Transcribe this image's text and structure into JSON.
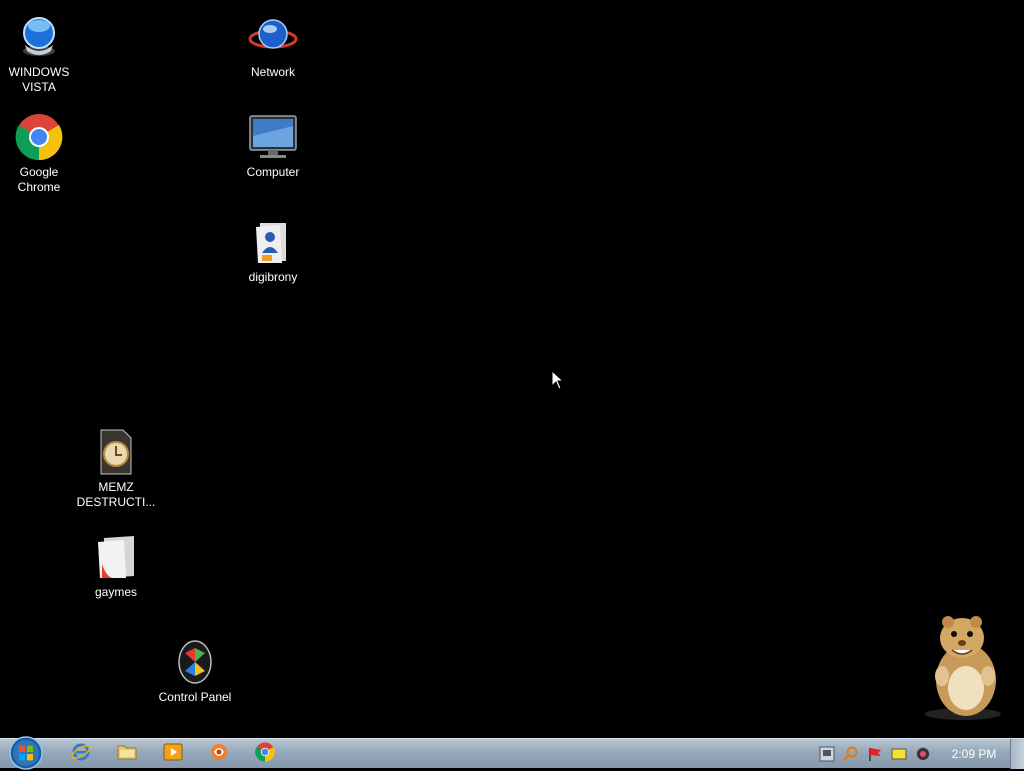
{
  "desktop": {
    "icons": [
      {
        "label": "WINDOWS\nVISTA",
        "icon": "windows-vista-orb-icon"
      },
      {
        "label": "Google\nChrome",
        "icon": "chrome-icon"
      },
      {
        "label": "Network",
        "icon": "network-globe-icon"
      },
      {
        "label": "Computer",
        "icon": "computer-monitor-icon"
      },
      {
        "label": "digibrony",
        "icon": "user-folder-icon"
      },
      {
        "label": "MEMZ\nDESTRUCTI...",
        "icon": "memz-file-icon"
      },
      {
        "label": "gaymes",
        "icon": "folder-icon"
      },
      {
        "label": "Control Panel",
        "icon": "control-panel-icon"
      }
    ]
  },
  "taskbar": {
    "pinned": [
      {
        "name": "internet-explorer",
        "icon": "internet-explorer-icon"
      },
      {
        "name": "file-explorer",
        "icon": "folder-icon"
      },
      {
        "name": "media-player",
        "icon": "media-player-icon"
      },
      {
        "name": "app",
        "icon": "app-icon"
      },
      {
        "name": "chrome",
        "icon": "chrome-icon"
      }
    ],
    "tray": [
      {
        "icon": "network-tray-icon"
      },
      {
        "icon": "search-tray-icon"
      },
      {
        "icon": "flag-icon"
      },
      {
        "icon": "display-tray-icon"
      },
      {
        "icon": "volume-icon"
      }
    ],
    "clock": "2:09 PM"
  },
  "colors": {
    "desktop_bg": "#000000",
    "taskbar_top": "#b9c6d3",
    "taskbar_bottom": "#8597aa",
    "label_text": "#ffffff"
  }
}
